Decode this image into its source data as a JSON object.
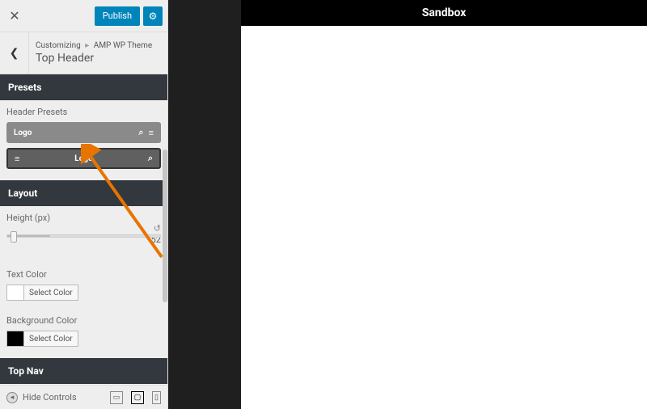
{
  "topbar": {
    "publish_label": "Publish"
  },
  "crumb": {
    "customizing": "Customizing",
    "theme": "AMP WP Theme",
    "title": "Top Header"
  },
  "sections": {
    "presets": "Presets",
    "layout": "Layout",
    "topnav": "Top Nav"
  },
  "presets": {
    "label": "Header Presets",
    "logo": "Logo"
  },
  "layout": {
    "height_label": "Height (px)",
    "height_value": "52",
    "text_color_label": "Text Color",
    "bg_color_label": "Background Color",
    "select_color": "Select Color"
  },
  "footer": {
    "hide_controls": "Hide Controls"
  },
  "preview": {
    "title": "Sandbox"
  }
}
